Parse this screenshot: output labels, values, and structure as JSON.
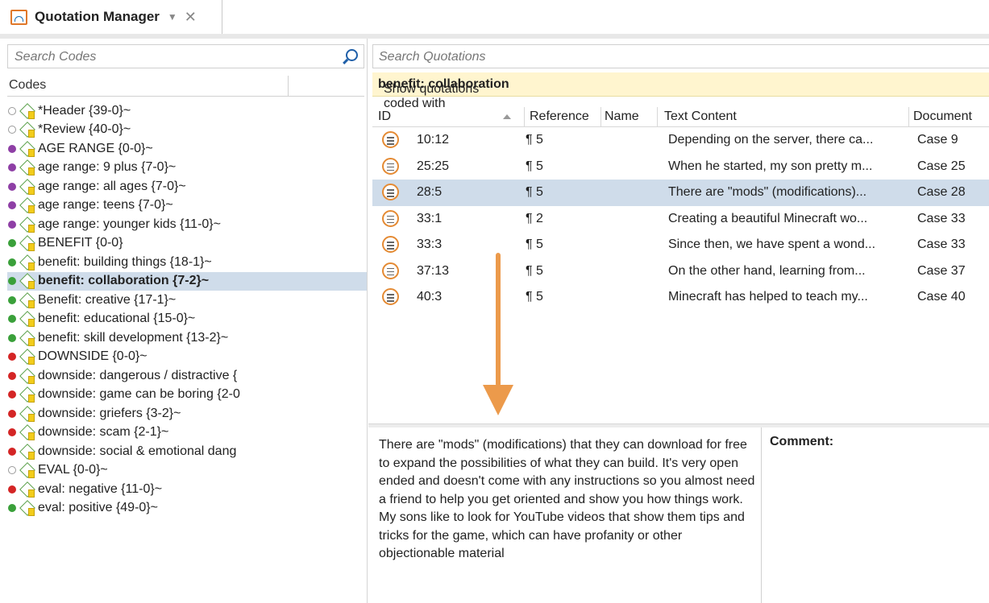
{
  "tab": {
    "title": "Quotation Manager",
    "dropdown": "▼",
    "close": "✕"
  },
  "codes_panel": {
    "search_placeholder": "Search Codes",
    "column_header": "Codes",
    "items": [
      {
        "label": "*Header {39-0}~",
        "dot": "hollow"
      },
      {
        "label": "*Review {40-0}~",
        "dot": "hollow"
      },
      {
        "label": "AGE RANGE {0-0}~",
        "dot": "#8e3fa5"
      },
      {
        "label": "age range: 9 plus {7-0}~",
        "dot": "#8e3fa5"
      },
      {
        "label": "age range: all ages {7-0}~",
        "dot": "#8e3fa5"
      },
      {
        "label": "age range: teens {7-0}~",
        "dot": "#8e3fa5"
      },
      {
        "label": "age range: younger kids {11-0}~",
        "dot": "#8e3fa5"
      },
      {
        "label": "BENEFIT {0-0}",
        "dot": "#3aa03a"
      },
      {
        "label": "benefit: building things {18-1}~",
        "dot": "#3aa03a"
      },
      {
        "label": "benefit: collaboration {7-2}~",
        "dot": "#3aa03a",
        "selected": true
      },
      {
        "label": "Benefit: creative {17-1}~",
        "dot": "#3aa03a"
      },
      {
        "label": "benefit: educational {15-0}~",
        "dot": "#3aa03a"
      },
      {
        "label": "benefit: skill development {13-2}~",
        "dot": "#3aa03a"
      },
      {
        "label": "DOWNSIDE {0-0}~",
        "dot": "#d42525"
      },
      {
        "label": "downside: dangerous / distractive {",
        "dot": "#d42525"
      },
      {
        "label": "downside: game can be boring {2-0",
        "dot": "#d42525"
      },
      {
        "label": "downside: griefers {3-2}~",
        "dot": "#d42525"
      },
      {
        "label": "downside: scam {2-1}~",
        "dot": "#d42525"
      },
      {
        "label": "downside: social & emotional dang",
        "dot": "#d42525"
      },
      {
        "label": "EVAL {0-0}~",
        "dot": "hollow"
      },
      {
        "label": "eval: negative {11-0}~",
        "dot": "#d42525"
      },
      {
        "label": "eval: positive {49-0}~",
        "dot": "#3aa03a"
      }
    ]
  },
  "quotations_panel": {
    "search_placeholder": "Search Quotations",
    "filter_prefix": "Show quotations coded with ",
    "filter_code": "benefit: collaboration",
    "columns": {
      "id": "ID",
      "reference": "Reference",
      "name": "Name",
      "text": "Text Content",
      "document": "Document"
    },
    "rows": [
      {
        "id": "10:12",
        "ref": "¶ 5",
        "text": "Depending on the server, there ca...",
        "doc": "Case 9"
      },
      {
        "id": "25:25",
        "ref": "¶ 5",
        "text": "When he started, my son pretty m...",
        "doc": "Case 25"
      },
      {
        "id": "28:5",
        "ref": "¶ 5",
        "text": "There are \"mods\" (modifications)...",
        "doc": "Case 28",
        "selected": true
      },
      {
        "id": "33:1",
        "ref": "¶ 2",
        "text": "Creating a beautiful Minecraft wo...",
        "doc": "Case 33"
      },
      {
        "id": "33:3",
        "ref": "¶ 5",
        "text": "Since then, we have spent a wond...",
        "doc": "Case 33"
      },
      {
        "id": "37:13",
        "ref": "¶ 5",
        "text": "On the other hand, learning from...",
        "doc": "Case 37"
      },
      {
        "id": "40:3",
        "ref": "¶ 5",
        "text": "Minecraft has helped to teach my...",
        "doc": "Case 40"
      }
    ]
  },
  "detail": {
    "text": "There are \"mods\" (modifications) that they can download for free to expand the possibilities of what they can build. It's very open ended and doesn't come with any instructions so you almost need a friend to help you get oriented and show you how things work. My sons like to look for YouTube videos that show them tips and tricks for the game, which can have profanity or other objectionable material",
    "comment_label": "Comment:"
  },
  "colors": {
    "selection": "#cfdcea",
    "filter_bg": "#fff5cf",
    "arrow": "#ec9a4b"
  }
}
